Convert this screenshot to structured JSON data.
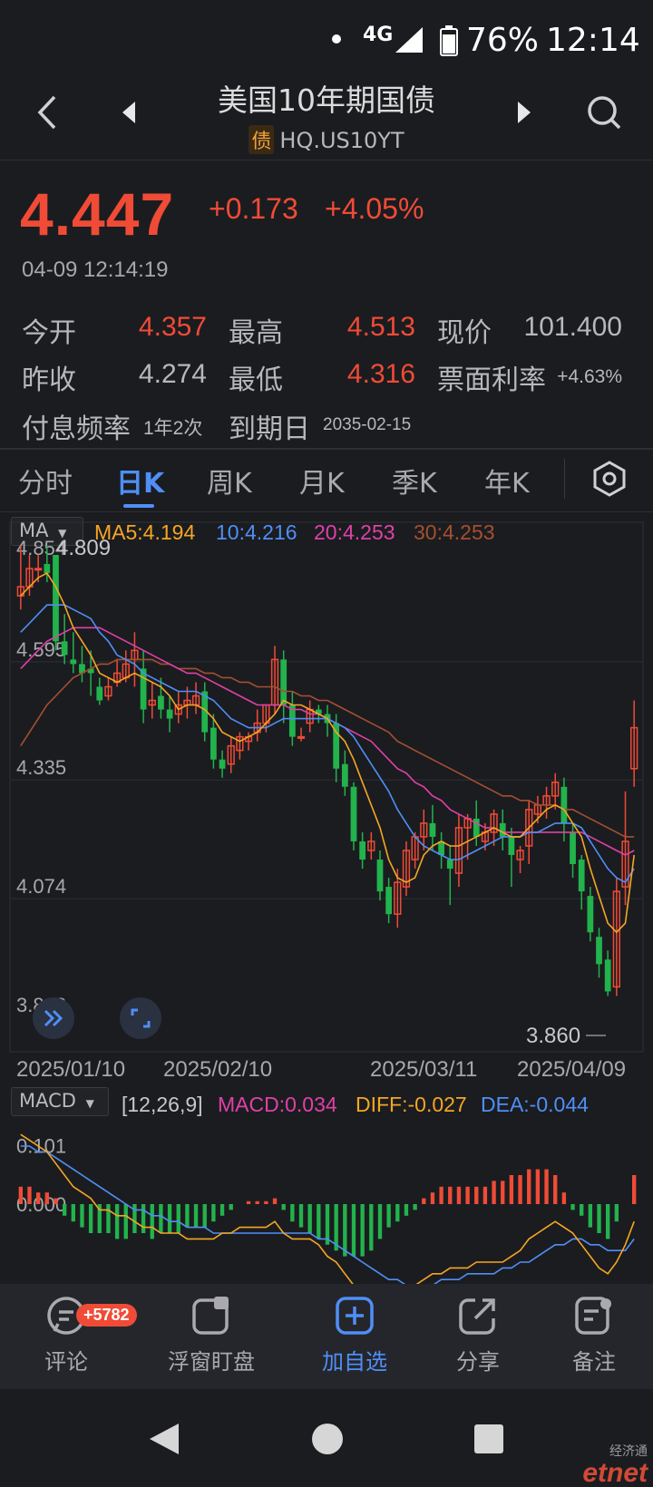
{
  "status_bar": {
    "network": "4G",
    "battery": "76%",
    "time": "12:14"
  },
  "header": {
    "title": "美国10年期国债",
    "tag": "债",
    "code": "HQ.US10YT"
  },
  "quote": {
    "price": "4.447",
    "change": "+0.173",
    "change_pct": "+4.05%",
    "timestamp": "04-09 12:14:19"
  },
  "stats": {
    "open_label": "今开",
    "open": "4.357",
    "high_label": "最高",
    "high": "4.513",
    "price_label": "现价",
    "clean_price": "101.400",
    "prev_label": "昨收",
    "prev": "4.274",
    "low_label": "最低",
    "low": "4.316",
    "coupon_label": "票面利率",
    "coupon": "+4.63%",
    "freq_label": "付息频率",
    "freq": "1年2次",
    "maturity_label": "到期日",
    "maturity": "2035-02-15"
  },
  "tabs": [
    "分时",
    "日K",
    "周K",
    "月K",
    "季K",
    "年K"
  ],
  "active_tab": "日K",
  "ma_legend": {
    "selector": "MA",
    "ma5": "MA5:4.194",
    "ma10": "10:4.216",
    "ma20": "20:4.253",
    "ma30": "30:4.253",
    "colors": {
      "ma5": "#f5a623",
      "ma10": "#4f8ff7",
      "ma20": "#e040a8",
      "ma30": "#a5502f"
    }
  },
  "macd_legend": {
    "selector": "MACD",
    "params": "[12,26,9]",
    "macd": "MACD:0.034",
    "diff": "DIFF:-0.027",
    "dea": "DEA:-0.044"
  },
  "chart_data": {
    "type": "candlestick",
    "y_axis_labels": [
      "4.854",
      "4.595",
      "4.335",
      "4.074",
      "3.813"
    ],
    "annotations": {
      "high_marker": "4.809",
      "low_marker": "3.860"
    },
    "x_axis_labels": [
      "2025/01/10",
      "2025/02/10",
      "2025/03/11",
      "2025/04/09"
    ],
    "ylim": [
      3.813,
      4.854
    ],
    "candles": [
      [
        4.74,
        4.85,
        4.76,
        4.71
      ],
      [
        4.76,
        4.83,
        4.8,
        4.74
      ],
      [
        4.8,
        4.83,
        4.8,
        4.77
      ],
      [
        4.81,
        4.85,
        4.79,
        4.77
      ],
      [
        4.83,
        4.83,
        4.64,
        4.62
      ],
      [
        4.64,
        4.7,
        4.61,
        4.59
      ],
      [
        4.6,
        4.66,
        4.59,
        4.57
      ],
      [
        4.59,
        4.63,
        4.57,
        4.55
      ],
      [
        4.58,
        4.62,
        4.57,
        4.52
      ],
      [
        4.54,
        4.56,
        4.51,
        4.5
      ],
      [
        4.52,
        4.56,
        4.54,
        4.51
      ],
      [
        4.55,
        4.6,
        4.57,
        4.54
      ],
      [
        4.56,
        4.62,
        4.59,
        4.55
      ],
      [
        4.6,
        4.66,
        4.62,
        4.54
      ],
      [
        4.58,
        4.62,
        4.49,
        4.46
      ],
      [
        4.5,
        4.55,
        4.51,
        4.47
      ],
      [
        4.52,
        4.56,
        4.49,
        4.47
      ],
      [
        4.49,
        4.52,
        4.47,
        4.44
      ],
      [
        4.48,
        4.53,
        4.5,
        4.46
      ],
      [
        4.5,
        4.54,
        4.51,
        4.47
      ],
      [
        4.5,
        4.55,
        4.52,
        4.48
      ],
      [
        4.53,
        4.55,
        4.44,
        4.42
      ],
      [
        4.45,
        4.48,
        4.38,
        4.36
      ],
      [
        4.38,
        4.4,
        4.36,
        4.34
      ],
      [
        4.37,
        4.43,
        4.41,
        4.35
      ],
      [
        4.4,
        4.44,
        4.43,
        4.38
      ],
      [
        4.42,
        4.44,
        4.43,
        4.4
      ],
      [
        4.44,
        4.49,
        4.46,
        4.42
      ],
      [
        4.46,
        4.5,
        4.5,
        4.44
      ],
      [
        4.5,
        4.63,
        4.6,
        4.48
      ],
      [
        4.6,
        4.62,
        4.5,
        4.46
      ],
      [
        4.5,
        4.53,
        4.43,
        4.41
      ],
      [
        4.43,
        4.45,
        4.43,
        4.42
      ],
      [
        4.46,
        4.51,
        4.49,
        4.44
      ],
      [
        4.49,
        4.5,
        4.48,
        4.46
      ],
      [
        4.48,
        4.5,
        4.46,
        4.43
      ],
      [
        4.46,
        4.48,
        4.36,
        4.33
      ],
      [
        4.37,
        4.4,
        4.32,
        4.3
      ],
      [
        4.32,
        4.33,
        4.2,
        4.18
      ],
      [
        4.2,
        4.22,
        4.16,
        4.14
      ],
      [
        4.18,
        4.22,
        4.2,
        4.16
      ],
      [
        4.16,
        4.18,
        4.09,
        4.07
      ],
      [
        4.1,
        4.12,
        4.04,
        4.02
      ],
      [
        4.04,
        4.14,
        4.11,
        4.01
      ],
      [
        4.1,
        4.2,
        4.18,
        4.08
      ],
      [
        4.16,
        4.22,
        4.21,
        4.14
      ],
      [
        4.21,
        4.27,
        4.24,
        4.18
      ],
      [
        4.24,
        4.28,
        4.21,
        4.18
      ],
      [
        4.2,
        4.22,
        4.17,
        4.14
      ],
      [
        4.16,
        4.19,
        4.14,
        4.06
      ],
      [
        4.13,
        4.26,
        4.23,
        4.1
      ],
      [
        4.23,
        4.26,
        4.25,
        4.16
      ],
      [
        4.25,
        4.29,
        4.21,
        4.19
      ],
      [
        4.2,
        4.24,
        4.22,
        4.18
      ],
      [
        4.22,
        4.27,
        4.26,
        4.19
      ],
      [
        4.24,
        4.27,
        4.21,
        4.18
      ],
      [
        4.21,
        4.23,
        4.17,
        4.1
      ],
      [
        4.16,
        4.19,
        4.18,
        4.13
      ],
      [
        4.19,
        4.29,
        4.27,
        4.15
      ],
      [
        4.26,
        4.3,
        4.28,
        4.24
      ],
      [
        4.28,
        4.32,
        4.3,
        4.25
      ],
      [
        4.3,
        4.35,
        4.33,
        4.27
      ],
      [
        4.32,
        4.34,
        4.24,
        4.2
      ],
      [
        4.22,
        4.24,
        4.15,
        4.12
      ],
      [
        4.16,
        4.17,
        4.09,
        4.05
      ],
      [
        4.08,
        4.1,
        4.0,
        3.98
      ],
      [
        3.99,
        4.01,
        3.93,
        3.9
      ],
      [
        3.94,
        3.96,
        3.87,
        3.86
      ],
      [
        3.88,
        4.12,
        4.09,
        3.86
      ],
      [
        4.1,
        4.31,
        4.2,
        4.06
      ],
      [
        4.36,
        4.51,
        4.45,
        4.32
      ]
    ],
    "ma5": [
      4.74,
      4.76,
      4.78,
      4.79,
      4.76,
      4.72,
      4.67,
      4.64,
      4.61,
      4.57,
      4.56,
      4.55,
      4.56,
      4.57,
      4.56,
      4.55,
      4.54,
      4.52,
      4.49,
      4.5,
      4.5,
      4.49,
      4.47,
      4.44,
      4.43,
      4.42,
      4.43,
      4.44,
      4.46,
      4.48,
      4.51,
      4.5,
      4.5,
      4.49,
      4.48,
      4.47,
      4.44,
      4.42,
      4.38,
      4.33,
      4.28,
      4.23,
      4.16,
      4.12,
      4.11,
      4.12,
      4.17,
      4.19,
      4.2,
      4.19,
      4.19,
      4.2,
      4.21,
      4.22,
      4.23,
      4.22,
      4.21,
      4.21,
      4.23,
      4.25,
      4.27,
      4.28,
      4.27,
      4.24,
      4.21,
      4.14,
      4.08,
      4.02,
      4.0,
      4.02,
      4.17
    ],
    "ma10": [
      4.66,
      4.68,
      4.7,
      4.72,
      4.72,
      4.72,
      4.71,
      4.7,
      4.69,
      4.66,
      4.64,
      4.61,
      4.6,
      4.59,
      4.57,
      4.56,
      4.55,
      4.54,
      4.53,
      4.53,
      4.53,
      4.52,
      4.51,
      4.49,
      4.47,
      4.46,
      4.45,
      4.45,
      4.45,
      4.46,
      4.47,
      4.47,
      4.47,
      4.47,
      4.47,
      4.47,
      4.46,
      4.45,
      4.43,
      4.4,
      4.37,
      4.34,
      4.31,
      4.27,
      4.24,
      4.21,
      4.19,
      4.18,
      4.17,
      4.16,
      4.16,
      4.17,
      4.18,
      4.19,
      4.2,
      4.21,
      4.21,
      4.21,
      4.22,
      4.22,
      4.23,
      4.24,
      4.24,
      4.24,
      4.23,
      4.2,
      4.17,
      4.14,
      4.12,
      4.11,
      4.14
    ],
    "ma20": [
      4.58,
      4.6,
      4.62,
      4.64,
      4.65,
      4.66,
      4.67,
      4.67,
      4.67,
      4.67,
      4.66,
      4.65,
      4.64,
      4.63,
      4.62,
      4.61,
      4.6,
      4.59,
      4.58,
      4.57,
      4.57,
      4.56,
      4.55,
      4.54,
      4.53,
      4.52,
      4.51,
      4.5,
      4.5,
      4.5,
      4.5,
      4.49,
      4.49,
      4.48,
      4.48,
      4.47,
      4.46,
      4.45,
      4.44,
      4.43,
      4.42,
      4.4,
      4.38,
      4.36,
      4.35,
      4.33,
      4.32,
      4.3,
      4.29,
      4.27,
      4.26,
      4.25,
      4.24,
      4.23,
      4.23,
      4.22,
      4.22,
      4.22,
      4.22,
      4.22,
      4.22,
      4.22,
      4.22,
      4.22,
      4.22,
      4.21,
      4.2,
      4.19,
      4.18,
      4.17,
      4.18
    ],
    "ma30": [
      4.41,
      4.44,
      4.47,
      4.5,
      4.52,
      4.54,
      4.56,
      4.57,
      4.58,
      4.59,
      4.59,
      4.6,
      4.6,
      4.6,
      4.6,
      4.6,
      4.59,
      4.59,
      4.58,
      4.58,
      4.58,
      4.57,
      4.57,
      4.56,
      4.56,
      4.55,
      4.55,
      4.54,
      4.54,
      4.54,
      4.53,
      4.53,
      4.52,
      4.52,
      4.51,
      4.51,
      4.5,
      4.49,
      4.48,
      4.47,
      4.46,
      4.45,
      4.44,
      4.42,
      4.41,
      4.4,
      4.39,
      4.38,
      4.37,
      4.36,
      4.35,
      4.34,
      4.33,
      4.32,
      4.31,
      4.3,
      4.3,
      4.29,
      4.29,
      4.28,
      4.28,
      4.28,
      4.27,
      4.27,
      4.26,
      4.25,
      4.24,
      4.23,
      4.22,
      4.21,
      4.21
    ]
  },
  "macd_chart": {
    "y_axis_labels": [
      "0.101",
      "0.000"
    ],
    "hist": [
      0.03,
      0.03,
      0.02,
      0.02,
      0.01,
      -0.02,
      -0.03,
      -0.04,
      -0.05,
      -0.05,
      -0.05,
      -0.06,
      -0.06,
      -0.05,
      -0.05,
      -0.06,
      -0.05,
      -0.05,
      -0.05,
      -0.04,
      -0.04,
      -0.04,
      -0.03,
      -0.02,
      -0.01,
      0.0,
      0.005,
      0.005,
      0.005,
      0.01,
      -0.01,
      -0.03,
      -0.04,
      -0.05,
      -0.06,
      -0.07,
      -0.08,
      -0.09,
      -0.09,
      -0.09,
      -0.08,
      -0.06,
      -0.04,
      -0.03,
      -0.02,
      -0.01,
      0.01,
      0.02,
      0.03,
      0.03,
      0.03,
      0.03,
      0.03,
      0.03,
      0.04,
      0.04,
      0.05,
      0.05,
      0.06,
      0.06,
      0.06,
      0.05,
      0.02,
      -0.01,
      -0.02,
      -0.04,
      -0.05,
      -0.06,
      -0.03,
      0.0,
      0.05
    ],
    "diff": [
      0.12,
      0.11,
      0.1,
      0.09,
      0.07,
      0.05,
      0.03,
      0.02,
      0.01,
      -0.01,
      -0.01,
      -0.02,
      -0.02,
      -0.03,
      -0.04,
      -0.04,
      -0.05,
      -0.05,
      -0.05,
      -0.06,
      -0.06,
      -0.06,
      -0.06,
      -0.05,
      -0.05,
      -0.04,
      -0.04,
      -0.04,
      -0.04,
      -0.03,
      -0.05,
      -0.06,
      -0.06,
      -0.06,
      -0.07,
      -0.09,
      -0.1,
      -0.12,
      -0.14,
      -0.15,
      -0.16,
      -0.17,
      -0.16,
      -0.16,
      -0.15,
      -0.14,
      -0.13,
      -0.12,
      -0.12,
      -0.11,
      -0.11,
      -0.11,
      -0.1,
      -0.1,
      -0.1,
      -0.1,
      -0.09,
      -0.08,
      -0.06,
      -0.05,
      -0.04,
      -0.03,
      -0.04,
      -0.05,
      -0.07,
      -0.09,
      -0.11,
      -0.12,
      -0.1,
      -0.07,
      -0.03
    ],
    "dea": [
      0.1,
      0.1,
      0.09,
      0.09,
      0.08,
      0.07,
      0.06,
      0.05,
      0.04,
      0.03,
      0.02,
      0.01,
      0.0,
      -0.01,
      -0.01,
      -0.02,
      -0.02,
      -0.03,
      -0.03,
      -0.04,
      -0.04,
      -0.04,
      -0.05,
      -0.05,
      -0.05,
      -0.05,
      -0.05,
      -0.05,
      -0.05,
      -0.05,
      -0.05,
      -0.05,
      -0.05,
      -0.05,
      -0.06,
      -0.06,
      -0.07,
      -0.08,
      -0.09,
      -0.1,
      -0.11,
      -0.12,
      -0.13,
      -0.13,
      -0.14,
      -0.14,
      -0.14,
      -0.14,
      -0.13,
      -0.13,
      -0.13,
      -0.12,
      -0.12,
      -0.12,
      -0.12,
      -0.11,
      -0.11,
      -0.1,
      -0.1,
      -0.09,
      -0.08,
      -0.07,
      -0.07,
      -0.06,
      -0.06,
      -0.07,
      -0.07,
      -0.08,
      -0.08,
      -0.08,
      -0.06
    ]
  },
  "bottom_nav": {
    "comment": "评论",
    "comment_badge": "+5782",
    "float": "浮窗盯盘",
    "add": "加自选",
    "share": "分享",
    "note": "备注"
  },
  "watermark": {
    "cn": "经济通",
    "en": "etnet"
  },
  "colors": {
    "up": "#f04b36",
    "down": "#22b34c",
    "accent": "#4f8ff7"
  }
}
